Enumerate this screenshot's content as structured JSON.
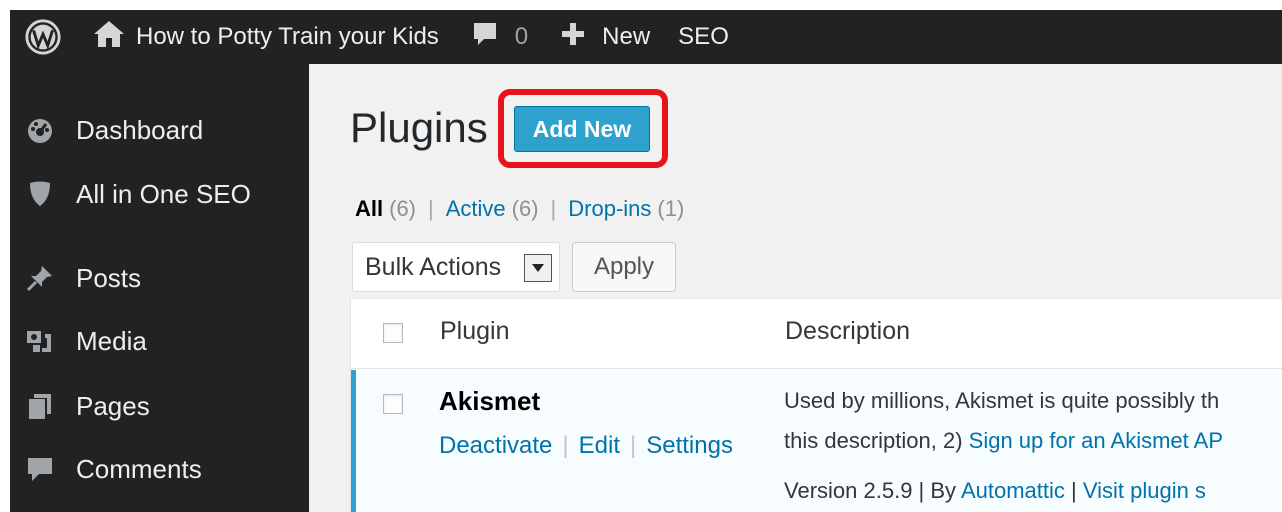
{
  "admin_bar": {
    "site_name": "How to Potty Train your Kids",
    "comment_count": "0",
    "new_label": "New",
    "seo_label": "SEO"
  },
  "sidebar": {
    "items": [
      {
        "label": "Dashboard",
        "icon": "dashboard-icon"
      },
      {
        "label": "All in One SEO",
        "icon": "shield-icon"
      },
      {
        "label": "Posts",
        "icon": "pin-icon"
      },
      {
        "label": "Media",
        "icon": "media-icon"
      },
      {
        "label": "Pages",
        "icon": "pages-icon"
      },
      {
        "label": "Comments",
        "icon": "comment-icon"
      }
    ]
  },
  "main": {
    "title": "Plugins",
    "add_new_label": "Add New",
    "filters": {
      "all_label": "All",
      "all_count": "(6)",
      "active_label": "Active",
      "active_count": "(6)",
      "dropins_label": "Drop-ins",
      "dropins_count": "(1)",
      "separator": "|"
    },
    "bulk_actions_label": "Bulk Actions",
    "apply_label": "Apply",
    "table": {
      "col_plugin": "Plugin",
      "col_description": "Description",
      "rows": [
        {
          "name": "Akismet",
          "actions": [
            "Deactivate",
            "Edit",
            "Settings"
          ],
          "desc_line1": "Used by millions, Akismet is quite possibly th",
          "desc_line2_prefix": "this description, 2) ",
          "desc_line2_link": "Sign up for an Akismet AP",
          "version_text": "Version 2.5.9 | By ",
          "author_link": "Automattic",
          "version_sep": " | ",
          "visit_link": "Visit plugin s"
        }
      ]
    }
  },
  "colors": {
    "admin_bg": "#222222",
    "accent_blue": "#2ea2cc",
    "link_blue": "#0073aa",
    "highlight_red": "#e8141b"
  }
}
